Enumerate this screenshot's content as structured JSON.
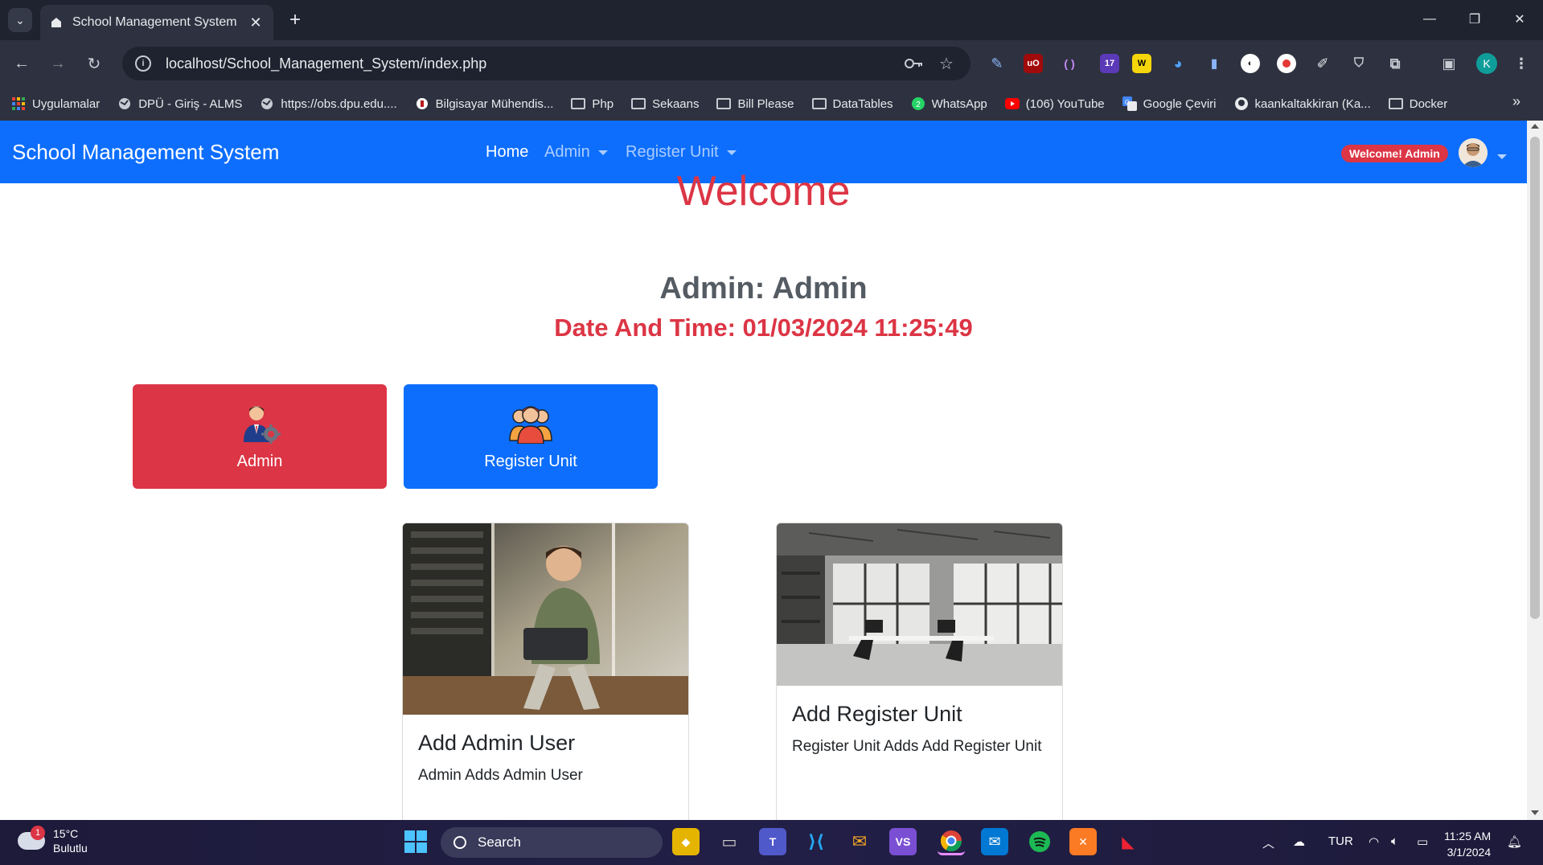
{
  "browser": {
    "tab_title": "School Management System",
    "url": "localhost/School_Management_System/index.php",
    "bookmarks": [
      {
        "label": "Uygulamalar",
        "icon": "apps-grid-icon"
      },
      {
        "label": "DPÜ - Giriş - ALMS",
        "icon": "globe-icon"
      },
      {
        "label": "https://obs.dpu.edu....",
        "icon": "globe-icon"
      },
      {
        "label": "Bilgisayar Mühendis...",
        "icon": "university-icon"
      },
      {
        "label": "Php",
        "icon": "folder-icon"
      },
      {
        "label": "Sekaans",
        "icon": "folder-icon"
      },
      {
        "label": "Bill Please",
        "icon": "folder-icon"
      },
      {
        "label": "DataTables",
        "icon": "folder-icon"
      },
      {
        "label": "WhatsApp",
        "icon": "whatsapp-icon"
      },
      {
        "label": "(106) YouTube",
        "icon": "youtube-icon"
      },
      {
        "label": "Google Çeviri",
        "icon": "google-translate-icon"
      },
      {
        "label": "kaankaltakkiran (Ka...",
        "icon": "github-icon"
      },
      {
        "label": "Docker",
        "icon": "folder-icon"
      }
    ],
    "profile_initial": "K",
    "extension_badge": "17"
  },
  "navbar": {
    "brand": "School Management System",
    "links": {
      "home": "Home",
      "admin": "Admin",
      "register_unit": "Register Unit"
    },
    "welcome_badge": "Welcome! Admin"
  },
  "hero": {
    "welcome": "Welcome",
    "admin_line": "Admin: Admin",
    "datetime": "Date And Time: 01/03/2024 11:25:49"
  },
  "tiles": {
    "admin": "Admin",
    "register_unit": "Register Unit"
  },
  "cards": [
    {
      "title": "Add Admin User",
      "text": "Admin Adds Admin User"
    },
    {
      "title": "Add Register Unit",
      "text": "Register Unit Adds Add Register Unit"
    }
  ],
  "taskbar": {
    "weather_temp": "15°C",
    "weather_desc": "Bulutlu",
    "weather_badge": "1",
    "search": "Search",
    "language": "TUR",
    "time": "11:25 AM",
    "date": "3/1/2024"
  },
  "colors": {
    "primary": "#0d6efd",
    "danger": "#dc3545"
  }
}
